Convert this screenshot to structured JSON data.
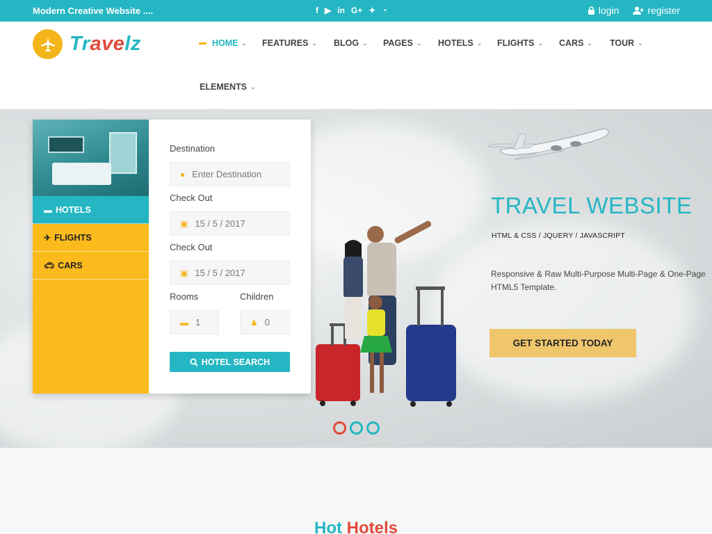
{
  "topbar": {
    "tagline": "Modern Creative Website ....",
    "social": [
      {
        "icon": "facebook-icon",
        "glyph": "f"
      },
      {
        "icon": "youtube-icon",
        "glyph": "▶"
      },
      {
        "icon": "linkedin-icon",
        "glyph": "in"
      },
      {
        "icon": "google-plus-icon",
        "glyph": "G+"
      },
      {
        "icon": "twitter-icon",
        "glyph": "✦"
      },
      {
        "icon": "rss-icon",
        "glyph": "◔"
      }
    ],
    "login": "login",
    "register": "register"
  },
  "logo": {
    "pre": "Tr",
    "hl": "ave",
    "post": "lz"
  },
  "nav": {
    "home": "HOME",
    "features": "FEATURES",
    "blog": "BLOG",
    "pages": "PAGES",
    "hotels": "HOTELS",
    "flights": "FLIGHTS",
    "cars": "CARS",
    "tour": "TOUR",
    "elements": "ELEMENTS"
  },
  "widget": {
    "tabs": {
      "hotels": "HOTELS",
      "flights": "FLIGHTS",
      "cars": "CARS"
    },
    "destination_label": "Destination",
    "destination_placeholder": "Enter Destination",
    "checkin_label": "Check Out",
    "checkin_value": "15 / 5 / 2017",
    "checkout_label": "Check Out",
    "checkout_value": "15 / 5 / 2017",
    "rooms_label": "Rooms",
    "rooms_value": "1",
    "children_label": "Children",
    "children_value": "0",
    "search_button": "HOTEL SEARCH"
  },
  "hero": {
    "title": "TRAVEL WEBSITE",
    "subtitle": "HTML & CSS / JQUERY / JAVASCRIPT",
    "description": "Responsive & Raw Multi-Purpose Multi-Page & One-Page HTML5 Template.",
    "cta": "GET STARTED TODAY"
  },
  "section": {
    "title_a": "Hot",
    "title_b": "Hotels"
  },
  "colors": {
    "accent": "#25b6c3",
    "yellow": "#fbbb1d",
    "red": "#e24b3b",
    "cta": "#f0c66d"
  }
}
